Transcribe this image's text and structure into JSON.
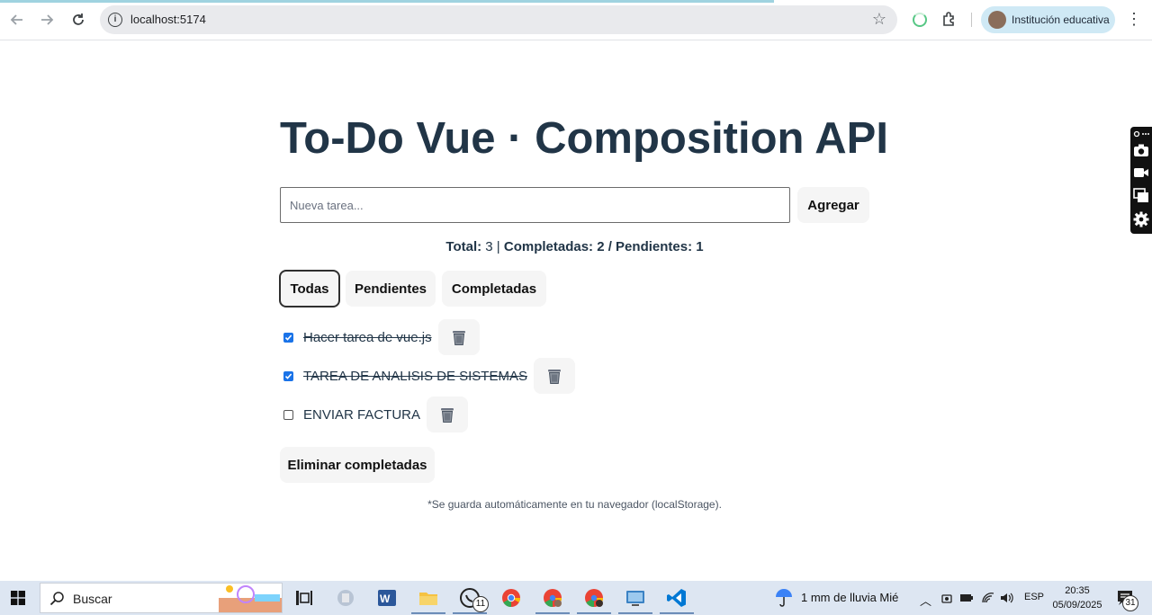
{
  "browser": {
    "url": "localhost:5174",
    "profile_label": "Institución educativa"
  },
  "app": {
    "title": "To-Do Vue · Composition API",
    "input_placeholder": "Nueva tarea...",
    "add_label": "Agregar",
    "stats": {
      "total_label": "Total:",
      "total_value": "3",
      "completed_label": "Completadas: 2 / Pendientes: 1"
    },
    "filters": [
      {
        "label": "Todas",
        "active": true
      },
      {
        "label": "Pendientes",
        "active": false
      },
      {
        "label": "Completadas",
        "active": false
      }
    ],
    "todos": [
      {
        "text": "Hacer tarea de vue.js",
        "done": true
      },
      {
        "text": "TAREA DE ANALISIS DE SISTEMAS",
        "done": true
      },
      {
        "text": "ENVIAR FACTURA",
        "done": false
      }
    ],
    "clear_completed_label": "Eliminar completadas",
    "footnote": "*Se guarda automáticamente en tu navegador (localStorage)."
  },
  "taskbar": {
    "search_label": "Buscar",
    "whatsapp_badge": "11",
    "weather": "1 mm de lluvia Mié",
    "language": "ESP",
    "time": "20:35",
    "date": "05/09/2025",
    "notification_count": "31"
  },
  "colors": {
    "title": "#213547",
    "button_bg": "#f5f5f5",
    "checkbox_checked": "#1a73e8",
    "taskbar_bg": "#dde6f2"
  }
}
